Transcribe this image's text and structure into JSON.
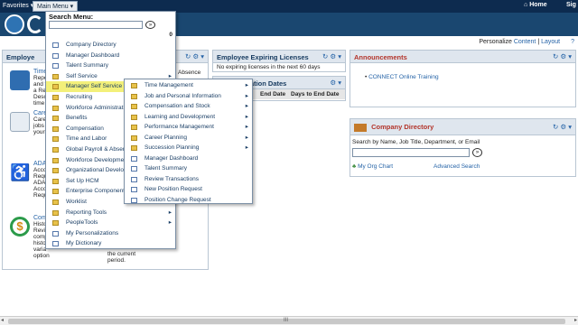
{
  "topbar": {
    "favorites": "Favorites ▾",
    "main_menu": "Main Menu ▾",
    "home": "Home",
    "sign_out": "Sig"
  },
  "personalize": {
    "prefix": "Personalize",
    "content": "Content",
    "sep": "|",
    "layout": "Layout",
    "help": "?"
  },
  "search_menu": {
    "title": "Search Menu:",
    "value": "",
    "go": "»",
    "count": "0"
  },
  "main_menu_items": [
    {
      "label": "Company Directory",
      "icon": "doc"
    },
    {
      "label": "Manager Dashboard",
      "icon": "doc"
    },
    {
      "label": "Talent Summary",
      "icon": "doc"
    },
    {
      "label": "Self Service",
      "icon": "folder",
      "submenu": true
    },
    {
      "label": "Manager Self Service",
      "icon": "folder",
      "submenu": true,
      "highlighted": true
    },
    {
      "label": "Recruiting",
      "icon": "folder",
      "submenu": true
    },
    {
      "label": "Workforce Administration",
      "icon": "folder",
      "submenu": true
    },
    {
      "label": "Benefits",
      "icon": "folder",
      "submenu": true
    },
    {
      "label": "Compensation",
      "icon": "folder",
      "submenu": true
    },
    {
      "label": "Time and Labor",
      "icon": "folder",
      "submenu": true
    },
    {
      "label": "Global Payroll & Absence Mgmt",
      "icon": "folder",
      "submenu": true
    },
    {
      "label": "Workforce Development",
      "icon": "folder",
      "submenu": true
    },
    {
      "label": "Organizational Development",
      "icon": "folder",
      "submenu": true
    },
    {
      "label": "Set Up HCM",
      "icon": "folder",
      "submenu": true
    },
    {
      "label": "Enterprise Components",
      "icon": "folder",
      "submenu": true
    },
    {
      "label": "Worklist",
      "icon": "folder",
      "submenu": true
    },
    {
      "label": "Reporting Tools",
      "icon": "folder",
      "submenu": true
    },
    {
      "label": "PeopleTools",
      "icon": "folder",
      "submenu": true
    },
    {
      "label": "My Personalizations",
      "icon": "doc"
    },
    {
      "label": "My Dictionary",
      "icon": "doc"
    }
  ],
  "mss_items": [
    {
      "label": "Time Management",
      "icon": "folder",
      "submenu": true
    },
    {
      "label": "Job and Personal Information",
      "icon": "folder",
      "submenu": true
    },
    {
      "label": "Compensation and Stock",
      "icon": "folder",
      "submenu": true
    },
    {
      "label": "Learning and Development",
      "icon": "folder",
      "submenu": true
    },
    {
      "label": "Performance Management",
      "icon": "folder",
      "submenu": true
    },
    {
      "label": "Career Planning",
      "icon": "folder",
      "submenu": true
    },
    {
      "label": "Succession Planning",
      "icon": "folder",
      "submenu": true
    },
    {
      "label": "Manager Dashboard",
      "icon": "doc"
    },
    {
      "label": "Talent Summary",
      "icon": "doc"
    },
    {
      "label": "Review Transactions",
      "icon": "doc"
    },
    {
      "label": "New Position Request",
      "icon": "doc"
    },
    {
      "label": "Position Change Request",
      "icon": "doc"
    }
  ],
  "left_pagelet": {
    "title": "Employe",
    "absence_label": "Absence",
    "rows": [
      {
        "title": "Time",
        "lines": [
          "Repo",
          "and t",
          "a Rep",
          "Desc",
          "time p"
        ]
      },
      {
        "title": "Caree",
        "lines": [
          "Caree",
          "jobs",
          "your c"
        ]
      },
      {
        "title": "ADA",
        "lines": [
          "Acco",
          "Requ",
          "ADA",
          "Acco",
          "Requ"
        ]
      },
      {
        "title": "Comp",
        "lines": [
          "Histo",
          "Revie",
          "comp",
          "histo",
          "varia",
          "option"
        ]
      }
    ],
    "period_lines": [
      "the current",
      "period."
    ]
  },
  "expiring": {
    "title": "Employee Expiring Licenses",
    "message": "No expiring licenses in the next 60 days"
  },
  "certification": {
    "title": "ration Dates",
    "end_date": "End Date",
    "days": "Days to End Date"
  },
  "announcements": {
    "title": "Announcements",
    "item": "CONNECT Online Training"
  },
  "company_directory": {
    "title": "Company Directory",
    "search_label": "Search by Name, Job Title, Department, or Email",
    "org_chart": "My Org Chart",
    "advanced": "Advanced Search",
    "go": "»"
  },
  "pagelet_controls": {
    "refresh": "↻",
    "gear": "⚙ ▾"
  },
  "scrollbar": {
    "left": "◂",
    "grip": "III",
    "right": "▸"
  }
}
